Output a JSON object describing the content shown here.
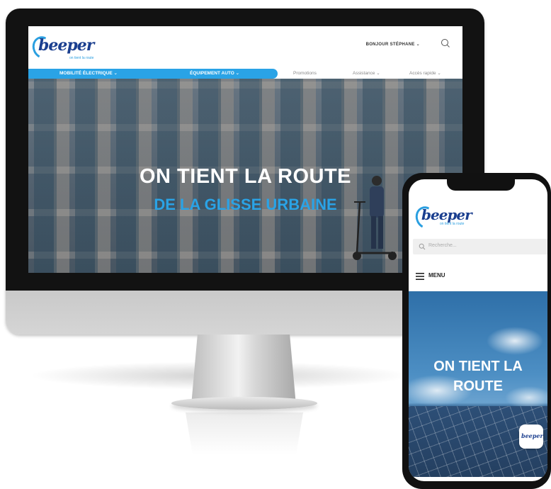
{
  "desktop": {
    "logo": {
      "word": "beeper",
      "tagline": "on tient la route"
    },
    "header": {
      "user_greeting": "BONJOUR STÉPHANE ⌄",
      "search_icon": "search-icon"
    },
    "nav": {
      "primary": [
        "MOBILITÉ ÉLECTRIQUE ⌄",
        "ÉQUIPEMENT AUTO ⌄"
      ],
      "secondary": [
        "Promotions",
        "Assistance ⌄",
        "Accès rapide ⌄"
      ]
    },
    "hero": {
      "title": "ON TIENT LA ROUTE",
      "subtitle": "DE LA GLISSE URBAINE"
    }
  },
  "mobile": {
    "logo": {
      "word": "beeper",
      "tagline": "on tient la route"
    },
    "search": {
      "placeholder": "Recherche..."
    },
    "menu_label": "MENU",
    "hero": {
      "title_line1": "ON TIENT LA",
      "title_line2": "ROUTE"
    },
    "badge": "beeper"
  },
  "colors": {
    "brand_blue": "#2aa3e6",
    "brand_navy": "#1b3f8f",
    "device_black": "#111111"
  }
}
